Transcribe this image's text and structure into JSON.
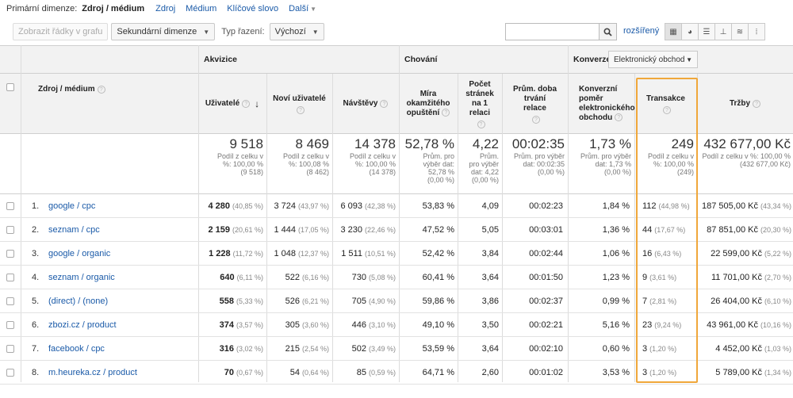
{
  "dimension_bar": {
    "label": "Primární dimenze:",
    "current": "Zdroj / médium",
    "options": [
      "Zdroj",
      "Médium",
      "Klíčové slovo",
      "Další"
    ]
  },
  "toolbar": {
    "plot_rows": "Zobrazit řádky v grafu",
    "secondary_dimension": "Sekundární dimenze",
    "sort_type_label": "Typ řazení:",
    "sort_type_value": "Výchozí",
    "search_value": "",
    "advanced": "rozšířený"
  },
  "groups": {
    "acquisition": "Akvizice",
    "behavior": "Chování",
    "conversions": "Konverze",
    "conversion_select": "Elektronický obchod"
  },
  "columns": {
    "source": "Zdroj / médium",
    "users": "Uživatelé",
    "new_users": "Noví uživatelé",
    "sessions": "Návštěvy",
    "bounce": "Míra okamžitého opuštění",
    "pages": "Počet stránek na 1 relaci",
    "duration": "Prům. doba trvání relace",
    "conv_rate": "Konverzní poměr elektronického obchodu",
    "transactions": "Transakce",
    "revenue": "Tržby"
  },
  "totals": {
    "users": {
      "big": "9 518",
      "l1": "Podíl z celku v",
      "l2": "%: 100,00 %",
      "l3": "(9 518)"
    },
    "new_users": {
      "big": "8 469",
      "l1": "Podíl z celku v",
      "l2": "%: 100,08 %",
      "l3": "(8 462)"
    },
    "sessions": {
      "big": "14 378",
      "l1": "Podíl z celku v",
      "l2": "%: 100,00 %",
      "l3": "(14 378)"
    },
    "bounce": {
      "big": "52,78 %",
      "l1": "Prům. pro",
      "l2": "výběr dat:",
      "l3": "52,78 %",
      "l4": "(0,00 %)"
    },
    "pages": {
      "big": "4,22",
      "l1": "Prům.",
      "l2": "pro výběr",
      "l3": "dat: 4,22",
      "l4": "(0,00 %)"
    },
    "duration": {
      "big": "00:02:35",
      "l1": "Prům. pro výběr",
      "l2": "dat: 00:02:35",
      "l3": "(0,00 %)"
    },
    "conv_rate": {
      "big": "1,73 %",
      "l1": "Prům. pro výběr",
      "l2": "dat: 1,73 %",
      "l3": "(0,00 %)"
    },
    "transactions": {
      "big": "249",
      "l1": "Podíl z celku v",
      "l2": "%: 100,00 %",
      "l3": "(249)"
    },
    "revenue": {
      "big": "432 677,00 Kč",
      "l1": "Podíl z celku v %: 100,00 %",
      "l2": "(432 677,00 Kč)"
    }
  },
  "rows": [
    {
      "n": "1.",
      "src": "google / cpc",
      "users": "4 280",
      "users_p": "(40,85 %)",
      "new": "3 724",
      "new_p": "(43,97 %)",
      "ses": "6 093",
      "ses_p": "(42,38 %)",
      "bounce": "53,83 %",
      "pages": "4,09",
      "dur": "00:02:23",
      "conv": "1,84 %",
      "tr": "112",
      "tr_p": "(44,98 %)",
      "rev": "187 505,00 Kč",
      "rev_p": "(43,34 %)"
    },
    {
      "n": "2.",
      "src": "seznam / cpc",
      "users": "2 159",
      "users_p": "(20,61 %)",
      "new": "1 444",
      "new_p": "(17,05 %)",
      "ses": "3 230",
      "ses_p": "(22,46 %)",
      "bounce": "47,52 %",
      "pages": "5,05",
      "dur": "00:03:01",
      "conv": "1,36 %",
      "tr": "44",
      "tr_p": "(17,67 %)",
      "rev": "87 851,00 Kč",
      "rev_p": "(20,30 %)"
    },
    {
      "n": "3.",
      "src": "google / organic",
      "users": "1 228",
      "users_p": "(11,72 %)",
      "new": "1 048",
      "new_p": "(12,37 %)",
      "ses": "1 511",
      "ses_p": "(10,51 %)",
      "bounce": "52,42 %",
      "pages": "3,84",
      "dur": "00:02:44",
      "conv": "1,06 %",
      "tr": "16",
      "tr_p": "(6,43 %)",
      "rev": "22 599,00 Kč",
      "rev_p": "(5,22 %)"
    },
    {
      "n": "4.",
      "src": "seznam / organic",
      "users": "640",
      "users_p": "(6,11 %)",
      "new": "522",
      "new_p": "(6,16 %)",
      "ses": "730",
      "ses_p": "(5,08 %)",
      "bounce": "60,41 %",
      "pages": "3,64",
      "dur": "00:01:50",
      "conv": "1,23 %",
      "tr": "9",
      "tr_p": "(3,61 %)",
      "rev": "11 701,00 Kč",
      "rev_p": "(2,70 %)"
    },
    {
      "n": "5.",
      "src": "(direct) / (none)",
      "users": "558",
      "users_p": "(5,33 %)",
      "new": "526",
      "new_p": "(6,21 %)",
      "ses": "705",
      "ses_p": "(4,90 %)",
      "bounce": "59,86 %",
      "pages": "3,86",
      "dur": "00:02:37",
      "conv": "0,99 %",
      "tr": "7",
      "tr_p": "(2,81 %)",
      "rev": "26 404,00 Kč",
      "rev_p": "(6,10 %)"
    },
    {
      "n": "6.",
      "src": "zbozi.cz / product",
      "users": "374",
      "users_p": "(3,57 %)",
      "new": "305",
      "new_p": "(3,60 %)",
      "ses": "446",
      "ses_p": "(3,10 %)",
      "bounce": "49,10 %",
      "pages": "3,50",
      "dur": "00:02:21",
      "conv": "5,16 %",
      "tr": "23",
      "tr_p": "(9,24 %)",
      "rev": "43 961,00 Kč",
      "rev_p": "(10,16 %)"
    },
    {
      "n": "7.",
      "src": "facebook / cpc",
      "users": "316",
      "users_p": "(3,02 %)",
      "new": "215",
      "new_p": "(2,54 %)",
      "ses": "502",
      "ses_p": "(3,49 %)",
      "bounce": "53,59 %",
      "pages": "3,64",
      "dur": "00:02:10",
      "conv": "0,60 %",
      "tr": "3",
      "tr_p": "(1,20 %)",
      "rev": "4 452,00 Kč",
      "rev_p": "(1,03 %)"
    },
    {
      "n": "8.",
      "src": "m.heureka.cz / product",
      "users": "70",
      "users_p": "(0,67 %)",
      "new": "54",
      "new_p": "(0,64 %)",
      "ses": "85",
      "ses_p": "(0,59 %)",
      "bounce": "64,71 %",
      "pages": "2,60",
      "dur": "00:01:02",
      "conv": "3,53 %",
      "tr": "3",
      "tr_p": "(1,20 %)",
      "rev": "5 789,00 Kč",
      "rev_p": "(1,34 %)"
    }
  ],
  "colors": {
    "link": "#1a5aa8",
    "highlight": "#f0a73a"
  }
}
